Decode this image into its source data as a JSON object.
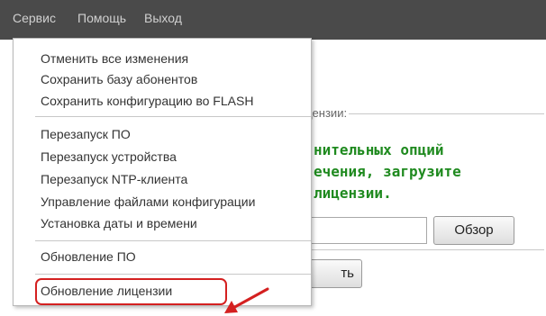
{
  "menubar": {
    "items": [
      "Сервис",
      "Помощь",
      "Выход"
    ]
  },
  "license_panel": {
    "legend": "ицензии:",
    "lines": [
      "нительных опций",
      "ечения, загрузите",
      "лицензии."
    ],
    "browse_label": "Обзор",
    "upload_label": "ть"
  },
  "dropdown": {
    "group1": [
      "Отменить все изменения",
      "Сохранить базу абонентов",
      "Сохранить конфигурацию во FLASH"
    ],
    "group2": [
      "Перезапуск ПО",
      "Перезапуск устройства",
      "Перезапуск NTP-клиента",
      "Управление файлами конфигурации",
      "Установка даты и времени"
    ],
    "group3": [
      "Обновление ПО"
    ],
    "group4": [
      "Обновление лицензии"
    ]
  },
  "colors": {
    "menubar_bg": "#4a4a4a",
    "highlight": "#d42020",
    "license_text": "#1f8a1f"
  }
}
